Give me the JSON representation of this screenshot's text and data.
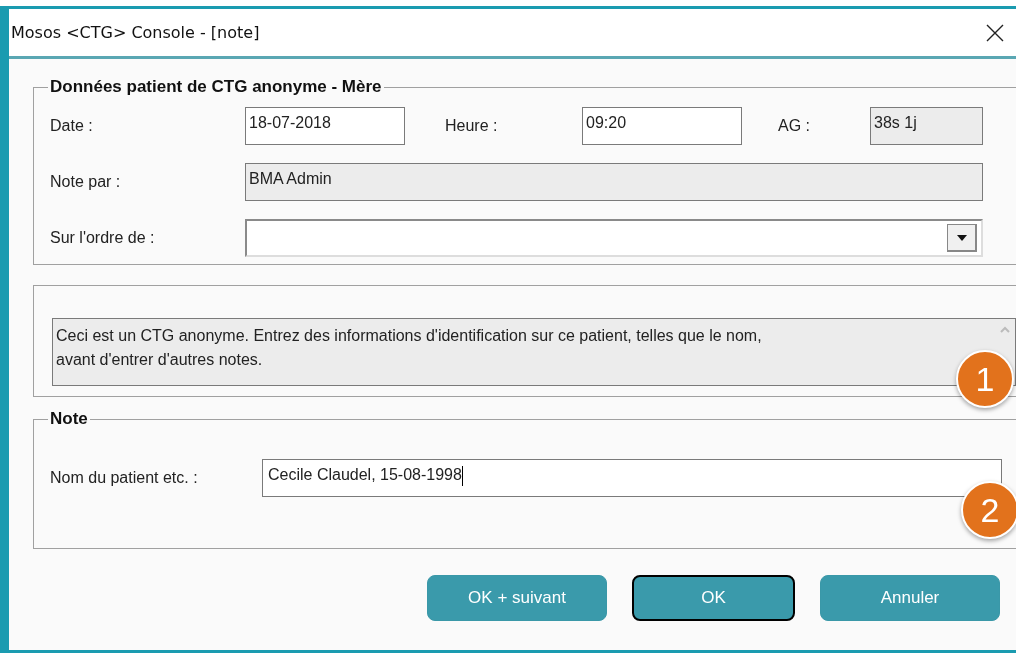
{
  "window": {
    "title": "Mosos <CTG> Console - [note]"
  },
  "patient_group": {
    "title": "Données patient de CTG anonyme - Mère",
    "date_label": "Date :",
    "date": "18-07-2018",
    "time_label": "Heure :",
    "time": "09:20",
    "ga_label": "AG :",
    "ga": "38s 1j",
    "note_by_label": "Note par :",
    "note_by": "BMA Admin",
    "ordered_by_label": "Sur l'ordre de :"
  },
  "info": {
    "message": "Ceci est un CTG anonyme. Entrez des informations d'identification sur ce patient, telles que le nom,\navant d'entrer d'autres notes."
  },
  "note_group": {
    "title": "Note",
    "patient_label": "Nom du patient etc. :",
    "patient_value": "Cecile Claudel, 15-08-1998"
  },
  "callouts": [
    "1",
    "2"
  ],
  "buttons": [
    {
      "label": "OK + suivant",
      "default": false
    },
    {
      "label": "OK",
      "default": true
    },
    {
      "label": "Annuler",
      "default": false
    }
  ]
}
